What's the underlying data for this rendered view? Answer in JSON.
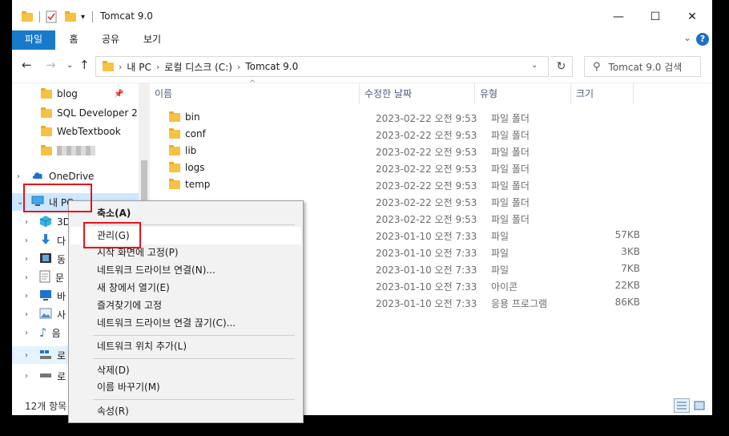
{
  "window": {
    "title": "Tomcat 9.0",
    "minimize": "—",
    "maximize": "☐",
    "close": "✕"
  },
  "ribbon": {
    "tabs": [
      "파일",
      "홈",
      "공유",
      "보기"
    ],
    "help": "?"
  },
  "address": {
    "crumbs": [
      "내 PC",
      "로컬 디스크 (C:)",
      "Tomcat 9.0"
    ],
    "search_placeholder": "Tomcat 9.0 검색"
  },
  "nav": {
    "quick_items": [
      {
        "label": "blog",
        "pinned": true
      },
      {
        "label": "SQL Developer 2"
      },
      {
        "label": "WebTextbook"
      }
    ],
    "onedrive": "OneDrive",
    "this_pc": "내 PC",
    "pc_items": [
      "3D",
      "다",
      "동",
      "문",
      "바",
      "사",
      "음",
      "로",
      "로"
    ]
  },
  "columns": {
    "name": "이름",
    "date": "수정한 날짜",
    "type": "유형",
    "size": "크기"
  },
  "files": [
    {
      "name": "bin",
      "date": "2023-02-22 오전 9:53",
      "type": "파일 폴더",
      "size": ""
    },
    {
      "name": "conf",
      "date": "2023-02-22 오전 9:53",
      "type": "파일 폴더",
      "size": ""
    },
    {
      "name": "lib",
      "date": "2023-02-22 오전 9:53",
      "type": "파일 폴더",
      "size": ""
    },
    {
      "name": "logs",
      "date": "2023-02-22 오전 9:53",
      "type": "파일 폴더",
      "size": ""
    },
    {
      "name": "temp",
      "date": "2023-02-22 오전 9:53",
      "type": "파일 폴더",
      "size": ""
    },
    {
      "name": "",
      "date": "2023-02-22 오전 9:53",
      "type": "파일 폴더",
      "size": ""
    },
    {
      "name": "",
      "date": "2023-02-22 오전 9:53",
      "type": "파일 폴더",
      "size": ""
    },
    {
      "name": "",
      "date": "2023-01-10 오전 7:33",
      "type": "파일",
      "size": "57KB"
    },
    {
      "name": "",
      "date": "2023-01-10 오전 7:33",
      "type": "파일",
      "size": "3KB"
    },
    {
      "name": "",
      "date": "2023-01-10 오전 7:33",
      "type": "파일",
      "size": "7KB"
    },
    {
      "name": "",
      "date": "2023-01-10 오전 7:33",
      "type": "아이콘",
      "size": "22KB"
    },
    {
      "name": "",
      "date": "2023-01-10 오전 7:33",
      "type": "응용 프로그램",
      "size": "86KB"
    }
  ],
  "status": {
    "count": "12개 항목"
  },
  "context_menu": {
    "collapse": "축소(A)",
    "manage": "관리(G)",
    "pin_start": "시작 화면에 고정(P)",
    "map_drive": "네트워크 드라이브 연결(N)...",
    "open_new_window": "새 창에서 열기(E)",
    "pin_quick": "즐겨찾기에 고정",
    "disconnect_drive": "네트워크 드라이브 연결 끊기(C)...",
    "add_network_location": "네트워크 위치 추가(L)",
    "delete": "삭제(D)",
    "rename": "이름 바꾸기(M)",
    "properties": "속성(R)"
  },
  "colors": {
    "accent": "#1979ca",
    "selection": "#cce8ff",
    "highlight_box": "#e8121b",
    "folder": "#f5c243"
  }
}
